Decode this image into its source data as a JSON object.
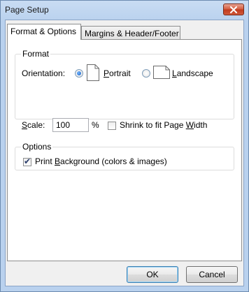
{
  "window": {
    "title": "Page Setup"
  },
  "tabs": [
    {
      "label": "Format & Options"
    },
    {
      "label": "Margins & Header/Footer"
    }
  ],
  "format": {
    "group_label": "Format",
    "orientation_label": "Orientation:",
    "portrait_rest": "ortrait",
    "portrait_mnemonic": "P",
    "landscape_rest": "andscape",
    "landscape_mnemonic": "L",
    "selected_orientation": "portrait",
    "scale_mnemonic": "S",
    "scale_label_rest": "cale:",
    "scale_value": "100",
    "scale_unit": "%",
    "shrink_label_pre": "Shrink to fit Page ",
    "shrink_mnemonic": "W",
    "shrink_label_post": "idth",
    "shrink_checked": false
  },
  "options": {
    "group_label": "Options",
    "print_bg_pre": "Print ",
    "print_bg_mnemonic": "B",
    "print_bg_post": "ackground (colors & images)",
    "print_bg_checked": true
  },
  "buttons": {
    "ok": "OK",
    "cancel": "Cancel"
  }
}
